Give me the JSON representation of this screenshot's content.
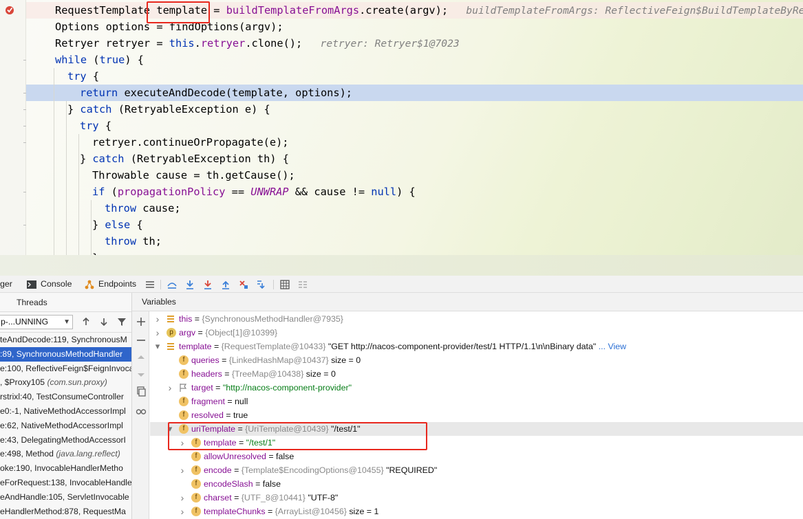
{
  "editor": {
    "lines": [
      {
        "segments": [
          [
            "plain",
            "RequestTemplate "
          ],
          [
            "plain",
            "template"
          ],
          [
            "plain",
            " = "
          ],
          [
            "field",
            "buildTemplateFromArgs"
          ],
          [
            "plain",
            ".create(argv);"
          ]
        ],
        "hint": "buildTemplateFromArgs: ReflectiveFeign$BuildTemplateByRes"
      },
      {
        "segments": [
          [
            "plain",
            "Options options = findOptions(argv);"
          ]
        ],
        "hint": ""
      },
      {
        "segments": [
          [
            "plain",
            "Retryer retryer = "
          ],
          [
            "kw",
            "this"
          ],
          [
            "plain",
            "."
          ],
          [
            "field",
            "retryer"
          ],
          [
            "plain",
            ".clone();"
          ]
        ],
        "hint": "retryer: Retryer$1@7023"
      },
      {
        "segments": [
          [
            "kw",
            "while"
          ],
          [
            "plain",
            " ("
          ],
          [
            "kw",
            "true"
          ],
          [
            "plain",
            ") {"
          ]
        ],
        "hint": ""
      },
      {
        "segments": [
          [
            "kw",
            "try"
          ],
          [
            "plain",
            " {"
          ]
        ],
        "hint": ""
      },
      {
        "segments": [
          [
            "kw",
            "return"
          ],
          [
            "plain",
            " executeAndDecode(template, options);"
          ]
        ],
        "hint": ""
      },
      {
        "segments": [
          [
            "plain",
            "} "
          ],
          [
            "kw",
            "catch"
          ],
          [
            "plain",
            " (RetryableException e) {"
          ]
        ],
        "hint": ""
      },
      {
        "segments": [
          [
            "kw",
            "try"
          ],
          [
            "plain",
            " {"
          ]
        ],
        "hint": ""
      },
      {
        "segments": [
          [
            "plain",
            "retryer.continueOrPropagate(e);"
          ]
        ],
        "hint": ""
      },
      {
        "segments": [
          [
            "plain",
            "} "
          ],
          [
            "kw",
            "catch"
          ],
          [
            "plain",
            " (RetryableException th) {"
          ]
        ],
        "hint": ""
      },
      {
        "segments": [
          [
            "plain",
            "Throwable cause = th.getCause();"
          ]
        ],
        "hint": ""
      },
      {
        "segments": [
          [
            "kw",
            "if"
          ],
          [
            "plain",
            " ("
          ],
          [
            "field",
            "propagationPolicy"
          ],
          [
            "plain",
            " == "
          ],
          [
            "it",
            "UNWRAP"
          ],
          [
            "plain",
            " && cause != "
          ],
          [
            "kw",
            "null"
          ],
          [
            "plain",
            ") {"
          ]
        ],
        "hint": ""
      },
      {
        "segments": [
          [
            "kw",
            "throw"
          ],
          [
            "plain",
            " cause;"
          ]
        ],
        "hint": ""
      },
      {
        "segments": [
          [
            "plain",
            "} "
          ],
          [
            "kw",
            "else"
          ],
          [
            "plain",
            " {"
          ]
        ],
        "hint": ""
      },
      {
        "segments": [
          [
            "kw",
            "throw"
          ],
          [
            "plain",
            " th;"
          ]
        ],
        "hint": ""
      },
      {
        "segments": [
          [
            "plain",
            "}"
          ]
        ],
        "hint": ""
      }
    ]
  },
  "toolbar": {
    "tab_debugger": "ger",
    "tab_console": "Console",
    "tab_endpoints": "Endpoints"
  },
  "frames": {
    "header": "Threads",
    "thread_selector": "p-...UNNING",
    "items": [
      {
        "text": "teAndDecode:119, SynchronousM",
        "pkg": "",
        "selected": false
      },
      {
        "text": ":89, SynchronousMethodHandler",
        "pkg": "",
        "selected": true
      },
      {
        "text": "e:100, ReflectiveFeign$FeignInvoca",
        "pkg": "",
        "selected": false
      },
      {
        "text": ", $Proxy105 ",
        "pkg": "(com.sun.proxy)",
        "selected": false
      },
      {
        "text": "rstrixl:40, TestConsumeController",
        "pkg": "",
        "selected": false
      },
      {
        "text": "e0:-1, NativeMethodAccessorImpl",
        "pkg": "",
        "selected": false
      },
      {
        "text": "e:62, NativeMethodAccessorImpl",
        "pkg": "",
        "selected": false
      },
      {
        "text": "e:43, DelegatingMethodAccessorI",
        "pkg": "",
        "selected": false
      },
      {
        "text": "e:498, Method ",
        "pkg": "(java.lang.reflect)",
        "selected": false
      },
      {
        "text": "oke:190, InvocableHandlerMetho",
        "pkg": "",
        "selected": false
      },
      {
        "text": "eForRequest:138, InvocableHandle",
        "pkg": "",
        "selected": false
      },
      {
        "text": "eAndHandle:105, ServletInvocable",
        "pkg": "",
        "selected": false
      },
      {
        "text": "eHandlerMethod:878, RequestMa",
        "pkg": "",
        "selected": false
      }
    ]
  },
  "variables": {
    "header": "Variables",
    "rows": [
      {
        "indent": 0,
        "arrow": "right",
        "icon": "bars",
        "name": "this",
        "eq": " = ",
        "type": "{SynchronousMethodHandler@7935}",
        "value": "",
        "selected": false
      },
      {
        "indent": 0,
        "arrow": "right",
        "icon": "p",
        "name": "argv",
        "eq": " = ",
        "type": "{Object[1]@10399}",
        "value": "",
        "selected": false
      },
      {
        "indent": 0,
        "arrow": "down",
        "icon": "bars",
        "name": "template",
        "eq": " = ",
        "type": "{RequestTemplate@10433}",
        "value": " \"GET http://nacos-component-provider/test/1 HTTP/1.1\\n\\nBinary data\"",
        "link": "... View",
        "selected": false
      },
      {
        "indent": 1,
        "arrow": "",
        "icon": "f",
        "name": "queries",
        "eq": " = ",
        "type": "{LinkedHashMap@10437}",
        "value": "  size = 0",
        "selected": false
      },
      {
        "indent": 1,
        "arrow": "",
        "icon": "f",
        "name": "headers",
        "eq": " = ",
        "type": "{TreeMap@10438}",
        "value": "  size = 0",
        "selected": false
      },
      {
        "indent": 1,
        "arrow": "right",
        "icon": "flag",
        "name": "target",
        "eq": " = ",
        "type": "",
        "value": "",
        "str": "\"http://nacos-component-provider\"",
        "selected": false
      },
      {
        "indent": 1,
        "arrow": "",
        "icon": "f",
        "name": "fragment",
        "eq": " = ",
        "type": "",
        "value": "null",
        "selected": false
      },
      {
        "indent": 1,
        "arrow": "",
        "icon": "f",
        "name": "resolved",
        "eq": " = ",
        "type": "",
        "value": "true",
        "selected": false
      },
      {
        "indent": 1,
        "arrow": "down",
        "icon": "f",
        "name": "uriTemplate",
        "eq": " = ",
        "type": "{UriTemplate@10439}",
        "value": " \"/test/1\"",
        "selected": true
      },
      {
        "indent": 2,
        "arrow": "right",
        "icon": "f",
        "name": "template",
        "eq": " = ",
        "type": "",
        "value": "",
        "str": "\"/test/1\"",
        "selected": false
      },
      {
        "indent": 2,
        "arrow": "",
        "icon": "f",
        "name": "allowUnresolved",
        "eq": " = ",
        "type": "",
        "value": "false",
        "selected": false
      },
      {
        "indent": 2,
        "arrow": "right",
        "icon": "f",
        "name": "encode",
        "eq": " = ",
        "type": "{Template$EncodingOptions@10455}",
        "value": " \"REQUIRED\"",
        "selected": false
      },
      {
        "indent": 2,
        "arrow": "",
        "icon": "f",
        "name": "encodeSlash",
        "eq": " = ",
        "type": "",
        "value": "false",
        "selected": false
      },
      {
        "indent": 2,
        "arrow": "right",
        "icon": "f",
        "name": "charset",
        "eq": " = ",
        "type": "{UTF_8@10441}",
        "value": " \"UTF-8\"",
        "selected": false
      },
      {
        "indent": 2,
        "arrow": "right",
        "icon": "f",
        "name": "templateChunks",
        "eq": " = ",
        "type": "{ArrayList@10456}",
        "value": "  size = 1",
        "selected": false
      }
    ]
  },
  "colors": {
    "highlight_box": "#e8281e",
    "selection": "#2f65ca",
    "current_line": "#c9d8ef"
  }
}
